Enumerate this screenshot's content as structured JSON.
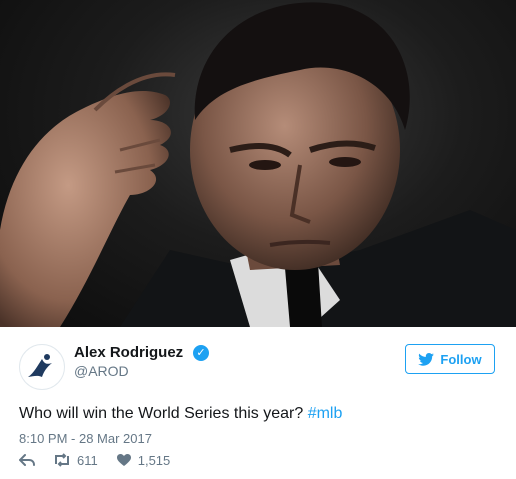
{
  "photo": {
    "alt_subject": "portrait"
  },
  "user": {
    "name": "Alex Rodriguez",
    "handle": "@AROD",
    "verified": true
  },
  "follow": {
    "label": "Follow"
  },
  "tweet": {
    "text": "Who will win the World Series this year? ",
    "hashtag": "#mlb",
    "timestamp": "8:10 PM - 28 Mar 2017"
  },
  "stats": {
    "retweets": "611",
    "likes": "1,515"
  },
  "colors": {
    "accent": "#1da1f2",
    "muted": "#657786",
    "text": "#14171a"
  },
  "icons": [
    "reply-icon",
    "retweet-icon",
    "heart-icon",
    "twitter-bird-icon",
    "verified-check-icon"
  ]
}
